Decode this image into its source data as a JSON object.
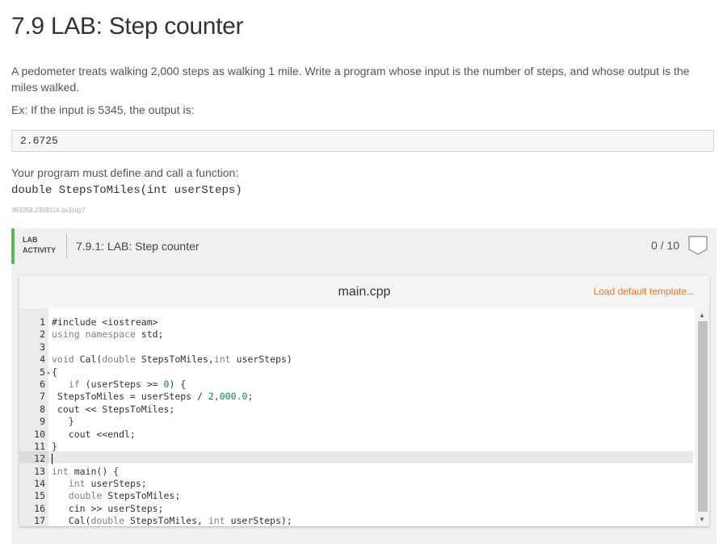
{
  "page": {
    "title": "7.9 LAB: Step counter",
    "description": "A pedometer treats walking 2,000 steps as walking 1 mile. Write a program whose input is the number of steps, and whose output is the miles walked.",
    "example_intro": "Ex: If the input is 5345, the output is:",
    "example_output": "2.6725",
    "must_define": "Your program must define and call a function:",
    "signature": "double StepsToMiles(int userSteps)",
    "tracking_id": "363258.2358114.qx3zqy7"
  },
  "lab": {
    "tag_line1": "LAB",
    "tag_line2": "ACTIVITY",
    "name": "7.9.1: LAB: Step counter",
    "score": "0 / 10",
    "accent_color": "#5cb85c"
  },
  "editor": {
    "file_name": "main.cpp",
    "load_template": "Load default template...",
    "load_template_color": "#e87722",
    "lines": [
      {
        "n": "1",
        "fold": "",
        "segs": [
          {
            "t": "#include <iostream>",
            "c": "typ"
          }
        ]
      },
      {
        "n": "2",
        "fold": "",
        "segs": [
          {
            "t": "using namespace",
            "c": "kw"
          },
          {
            "t": " std;",
            "c": "typ"
          }
        ]
      },
      {
        "n": "3",
        "fold": "",
        "segs": []
      },
      {
        "n": "4",
        "fold": "",
        "segs": [
          {
            "t": "void",
            "c": "kw"
          },
          {
            "t": " Cal(",
            "c": "typ"
          },
          {
            "t": "double",
            "c": "kw"
          },
          {
            "t": " StepsToMiles,",
            "c": "typ"
          },
          {
            "t": "int",
            "c": "kw"
          },
          {
            "t": " userSteps)",
            "c": "typ"
          }
        ]
      },
      {
        "n": "5",
        "fold": "▾",
        "segs": [
          {
            "t": "{",
            "c": "typ"
          }
        ]
      },
      {
        "n": "6",
        "fold": "",
        "segs": [
          {
            "t": "   ",
            "c": "typ"
          },
          {
            "t": "if",
            "c": "kw"
          },
          {
            "t": " (userSteps >= ",
            "c": "typ"
          },
          {
            "t": "0",
            "c": "num"
          },
          {
            "t": ") {",
            "c": "typ"
          }
        ]
      },
      {
        "n": "7",
        "fold": "",
        "segs": [
          {
            "t": " StepsToMiles = userSteps / ",
            "c": "typ"
          },
          {
            "t": "2,000.0",
            "c": "num"
          },
          {
            "t": ";",
            "c": "typ"
          }
        ]
      },
      {
        "n": "8",
        "fold": "",
        "segs": [
          {
            "t": " cout << StepsToMiles;",
            "c": "typ"
          }
        ]
      },
      {
        "n": "9",
        "fold": "",
        "segs": [
          {
            "t": "   }",
            "c": "typ"
          }
        ]
      },
      {
        "n": "10",
        "fold": "",
        "segs": [
          {
            "t": "   cout <<endl;",
            "c": "typ"
          }
        ]
      },
      {
        "n": "11",
        "fold": "",
        "segs": [
          {
            "t": "}",
            "c": "typ"
          }
        ]
      },
      {
        "n": "12",
        "fold": "",
        "segs": [],
        "cursor": true
      },
      {
        "n": "13",
        "fold": "",
        "segs": [
          {
            "t": "int",
            "c": "kw"
          },
          {
            "t": " main() {",
            "c": "typ"
          }
        ]
      },
      {
        "n": "14",
        "fold": "",
        "segs": [
          {
            "t": "   ",
            "c": "typ"
          },
          {
            "t": "int",
            "c": "kw"
          },
          {
            "t": " userSteps;",
            "c": "typ"
          }
        ]
      },
      {
        "n": "15",
        "fold": "",
        "segs": [
          {
            "t": "   ",
            "c": "typ"
          },
          {
            "t": "double",
            "c": "kw"
          },
          {
            "t": " StepsToMiles;",
            "c": "typ"
          }
        ]
      },
      {
        "n": "16",
        "fold": "",
        "segs": [
          {
            "t": "   cin >> userSteps;",
            "c": "typ"
          }
        ]
      },
      {
        "n": "17",
        "fold": "",
        "segs": [
          {
            "t": "   Cal(",
            "c": "typ"
          },
          {
            "t": "double",
            "c": "kw"
          },
          {
            "t": " StepsToMiles, ",
            "c": "typ"
          },
          {
            "t": "int",
            "c": "kw"
          },
          {
            "t": " userSteps);",
            "c": "typ"
          }
        ]
      }
    ]
  }
}
